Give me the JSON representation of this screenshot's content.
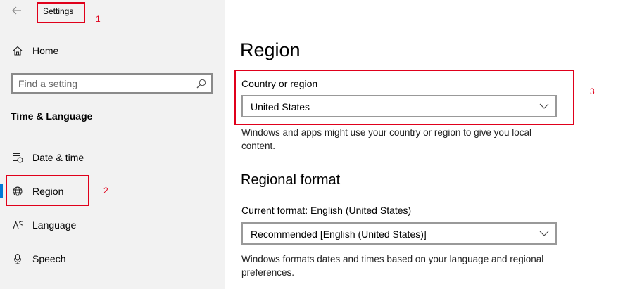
{
  "window": {
    "app_title": "Settings"
  },
  "sidebar": {
    "home_label": "Home",
    "search": {
      "placeholder": "Find a setting",
      "value": ""
    },
    "section_heading": "Time & Language",
    "items": [
      {
        "label": "Date & time",
        "icon": "calendar-clock-icon",
        "active": false
      },
      {
        "label": "Region",
        "icon": "globe-icon",
        "active": true
      },
      {
        "label": "Language",
        "icon": "language-icon",
        "active": false
      },
      {
        "label": "Speech",
        "icon": "microphone-icon",
        "active": false
      }
    ]
  },
  "main": {
    "title": "Region",
    "country": {
      "label": "Country or region",
      "selected": "United States",
      "description": "Windows and apps might use your country or region to give you local content."
    },
    "regional_format": {
      "heading": "Regional format",
      "current_label": "Current format: English (United States)",
      "selected": "Recommended [English (United States)]",
      "description": "Windows formats dates and times based on your language and regional preferences."
    }
  },
  "annotations": {
    "box1": "1",
    "box2": "2",
    "box3": "3"
  },
  "colors": {
    "accent": "#0078d7",
    "annotation": "#e0001b",
    "sidebar_bg": "#f2f2f2"
  }
}
